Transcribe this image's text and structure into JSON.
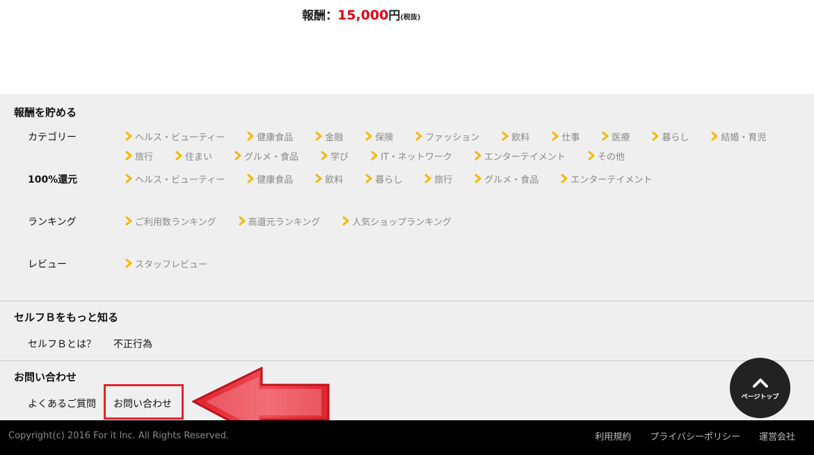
{
  "top": {
    "reward_label": "報酬：",
    "reward_amount": "15,000",
    "reward_yen": "円",
    "reward_tax": "(税抜)"
  },
  "sections": {
    "earn": {
      "title": "報酬を貯める",
      "category_label": "カテゴリー",
      "category_links": [
        "ヘルス・ビューティー",
        "健康食品",
        "金融",
        "保険",
        "ファッション",
        "飲料",
        "仕事",
        "医療",
        "暮らし",
        "結婚・育児",
        "旅行",
        "住まい",
        "グルメ・食品",
        "学び",
        "IT・ネットワーク",
        "エンターテイメント",
        "その他"
      ],
      "refund_label": "100%還元",
      "refund_links": [
        "ヘルス・ビューティー",
        "健康食品",
        "飲料",
        "暮らし",
        "旅行",
        "グルメ・食品",
        "エンターテイメント"
      ],
      "ranking_label": "ランキング",
      "ranking_links": [
        "ご利用数ランキング",
        "高還元ランキング",
        "人気ショップランキング"
      ],
      "review_label": "レビュー",
      "review_links": [
        "スタッフレビュー"
      ]
    },
    "about": {
      "title": "セルフＢをもっと知る",
      "link1": "セルフＢとは？",
      "link2": "不正行為"
    },
    "contact": {
      "title": "お問い合わせ",
      "link1": "よくあるご質問",
      "link2": "お問い合わせ"
    }
  },
  "pagetop": {
    "label": "ページトップ"
  },
  "bottom": {
    "copyright": "Copyright(c) 2016 For it Inc. All Rights Reserved.",
    "links": [
      "利用規約",
      "プライバシーポリシー",
      "運営会社"
    ]
  },
  "colors": {
    "accent_red": "#e60012",
    "chevron_yellow": "#f5b700",
    "footer_gray": "#efefef"
  }
}
